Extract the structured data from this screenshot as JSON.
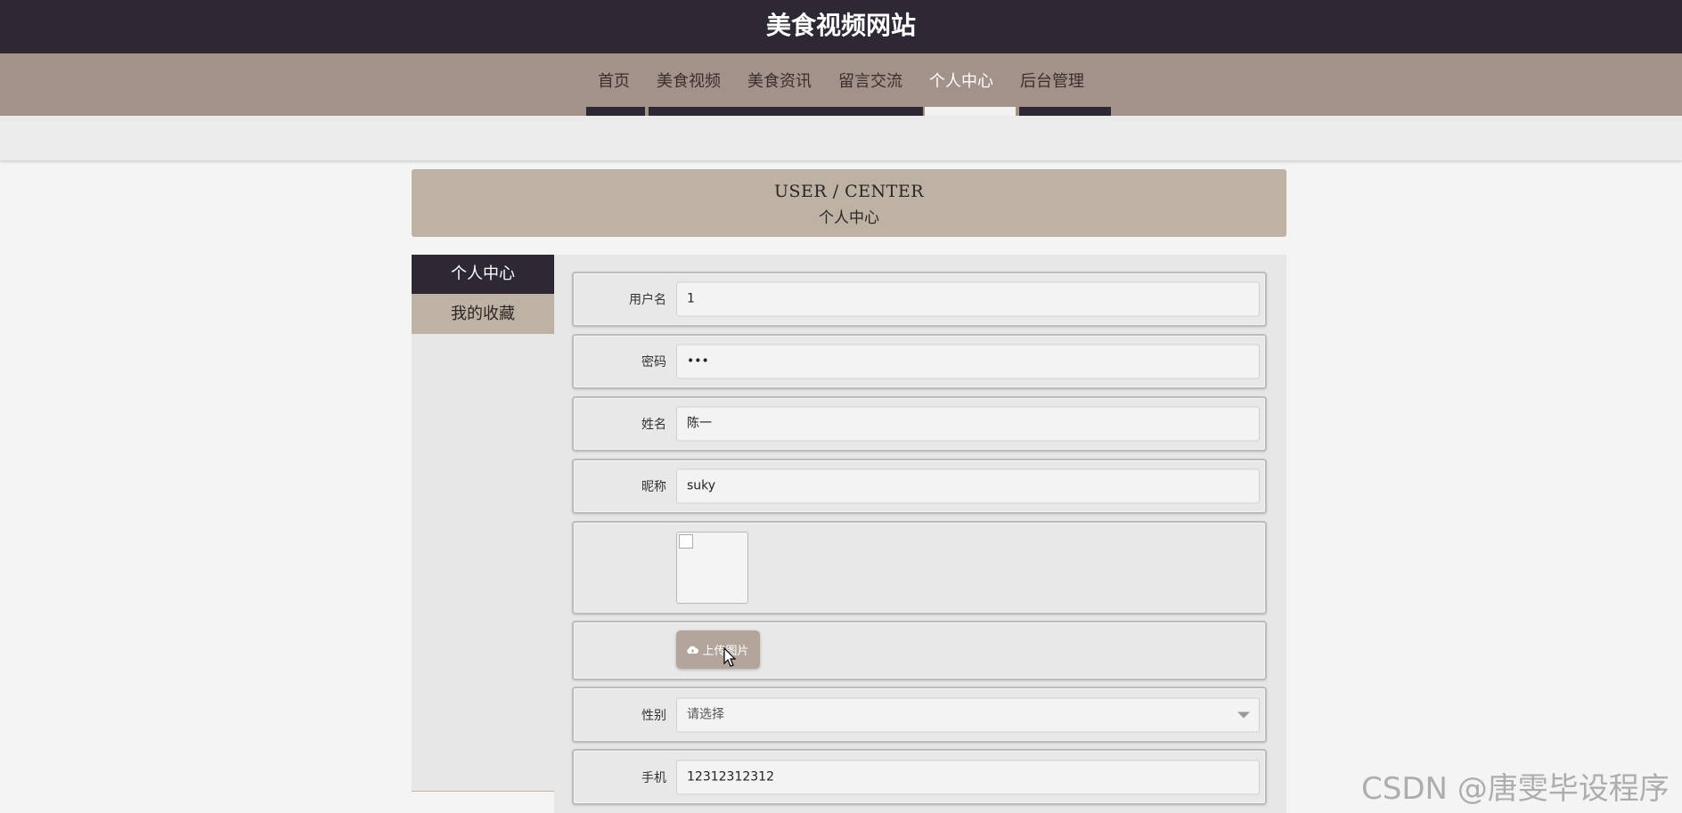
{
  "header": {
    "site_title": "美食视频网站"
  },
  "nav": {
    "items": [
      {
        "label": "首页"
      },
      {
        "label": "美食视频"
      },
      {
        "label": "美食资讯"
      },
      {
        "label": "留言交流"
      },
      {
        "label": "个人中心",
        "active": true
      },
      {
        "label": "后台管理"
      }
    ]
  },
  "banner": {
    "title_en": "USER / CENTER",
    "title_cn": "个人中心"
  },
  "sidebar": {
    "items": [
      {
        "label": "个人中心",
        "active": true
      },
      {
        "label": "我的收藏"
      }
    ]
  },
  "form": {
    "username": {
      "label": "用户名",
      "value": "1"
    },
    "password": {
      "label": "密码",
      "value": "•••"
    },
    "name": {
      "label": "姓名",
      "value": "陈一"
    },
    "nickname": {
      "label": "昵称",
      "value": "suky"
    },
    "avatar": {
      "icon": "broken-image-icon"
    },
    "upload": {
      "label": "上传图片",
      "icon": "cloud-upload-icon"
    },
    "gender": {
      "label": "性别",
      "placeholder": "请选择"
    },
    "phone": {
      "label": "手机",
      "value": "12312312312"
    }
  },
  "watermark": {
    "text": "CSDN @唐雯毕设程序"
  },
  "colors": {
    "header_bg": "#2e2835",
    "nav_bg": "#a29289",
    "banner_bg": "#bdb2a4",
    "accent_button": "#b3a59b"
  }
}
